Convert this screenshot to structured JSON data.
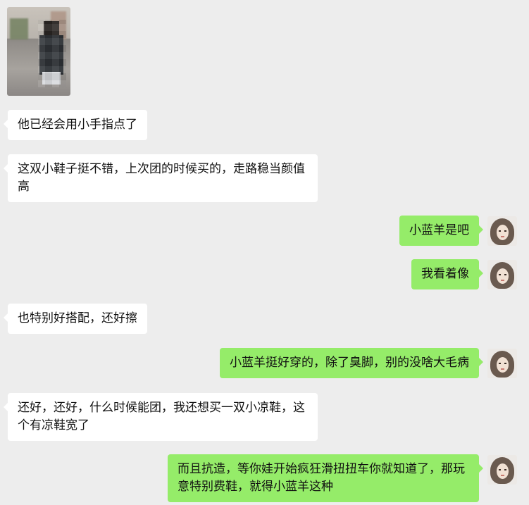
{
  "messages": [
    {
      "side": "left",
      "type": "image",
      "alt": ""
    },
    {
      "side": "left",
      "type": "text",
      "text": "他已经会用小手指点了"
    },
    {
      "side": "left",
      "type": "text",
      "text": "这双小鞋子挺不错，上次团的时候买的，走路稳当颜值高"
    },
    {
      "side": "right",
      "type": "text",
      "text": "小蓝羊是吧"
    },
    {
      "side": "right",
      "type": "text",
      "text": "我看着像"
    },
    {
      "side": "left",
      "type": "text",
      "text": "也特别好搭配，还好擦"
    },
    {
      "side": "right",
      "type": "text",
      "text": "小蓝羊挺好穿的，除了臭脚，别的没啥大毛病"
    },
    {
      "side": "left",
      "type": "text",
      "text": "还好，还好，什么时候能团，我还想买一双小凉鞋，这个有凉鞋宽了"
    },
    {
      "side": "right",
      "type": "text",
      "text": "而且抗造，等你娃开始疯狂滑扭扭车你就知道了，那玩意特别费鞋，就得小蓝羊这种"
    }
  ],
  "colors": {
    "background": "#ededed",
    "bubble_left": "#ffffff",
    "bubble_right": "#95ec69"
  },
  "icons": {
    "avatar": "user-avatar-icon"
  }
}
